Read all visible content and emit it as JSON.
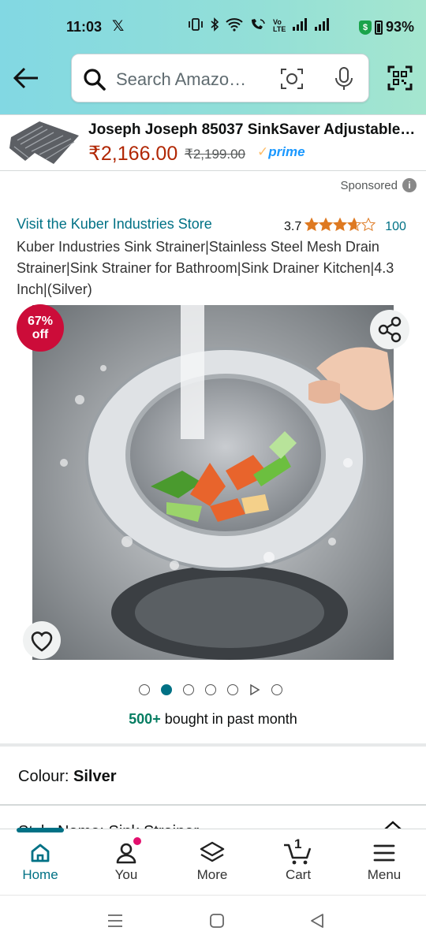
{
  "status_bar": {
    "time": "11:03",
    "app_icon": "x-logo-icon",
    "battery": "93%"
  },
  "header": {
    "search_placeholder": "Search Amazo…"
  },
  "banner": {
    "title": "Joseph Joseph 85037 SinkSaver Adjustable…",
    "price": "₹2,166.00",
    "mrp": "₹2,199.00",
    "prime_label": "prime"
  },
  "sponsored_label": "Sponsored",
  "product": {
    "store_link": "Visit the Kuber Industries Store",
    "rating": "3.7",
    "rating_value": 3.7,
    "rating_count": "100",
    "title": "Kuber Industries Sink Strainer|Stainless Steel Mesh Drain Strainer|Sink Strainer for Bathroom|Sink Drainer Kitchen|4.3 Inch|(Silver)",
    "discount_line1": "67%",
    "discount_line2": "off",
    "bought_count": "500+",
    "bought_text": " bought in past month",
    "colour_label": "Colour: ",
    "colour_value": "Silver",
    "style_label": "Style Name: Sink Strainer"
  },
  "carousel": {
    "total_dots": 7,
    "active_index": 1,
    "video_index": 5
  },
  "bottom_nav": [
    {
      "label": "Home",
      "icon": "home-icon",
      "active": true
    },
    {
      "label": "You",
      "icon": "user-icon",
      "active": false
    },
    {
      "label": "More",
      "icon": "layers-icon",
      "active": false
    },
    {
      "label": "Cart",
      "icon": "cart-icon",
      "active": false,
      "count": "1"
    },
    {
      "label": "Menu",
      "icon": "menu-icon",
      "active": false
    }
  ],
  "colors": {
    "accent": "#007185",
    "deal_red": "#cc0c39",
    "price_red": "#b12704",
    "star": "#de7921"
  }
}
